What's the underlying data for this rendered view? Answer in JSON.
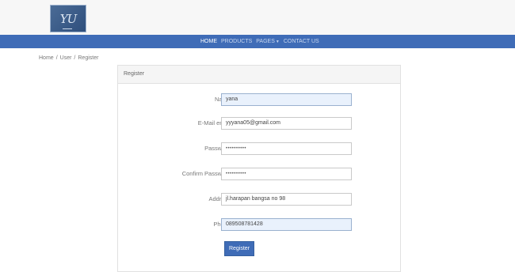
{
  "header": {
    "logo_text": "YU"
  },
  "nav": {
    "items": [
      {
        "label": "HOME",
        "active": true
      },
      {
        "label": "PRODUCTS",
        "active": false
      },
      {
        "label": "PAGES",
        "active": false,
        "dropdown": true
      },
      {
        "label": "CONTACT US",
        "active": false
      }
    ]
  },
  "breadcrumb": {
    "items": [
      "Home",
      "User",
      "Register"
    ],
    "separator": "/"
  },
  "form": {
    "title": "Register",
    "fields": [
      {
        "label": "Name",
        "value": "yana"
      },
      {
        "label": "E-Mail email",
        "value": "yyyana05@gmail.com"
      },
      {
        "label": "Password",
        "value": "••••••••••"
      },
      {
        "label": "Confirm Password",
        "value": "••••••••••"
      },
      {
        "label": "Address",
        "value": "jl.harapan bangsa no 98"
      },
      {
        "label": "Phone",
        "value": "089508781428"
      }
    ],
    "submit_label": "Register"
  },
  "colors": {
    "brand": "#3f6cb7",
    "autofill": "#e9f1fc"
  }
}
